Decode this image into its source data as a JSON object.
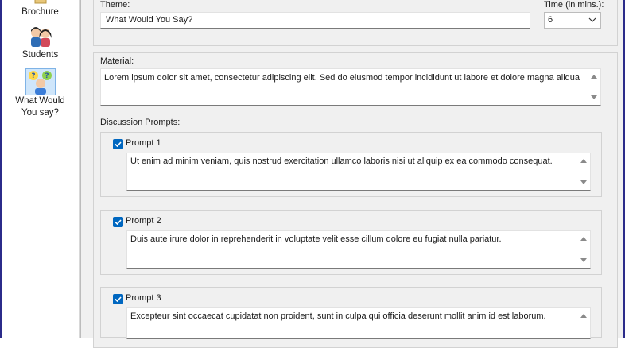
{
  "sidebar": {
    "items": [
      {
        "label": "Brochure",
        "icon": "brochure-icon"
      },
      {
        "label": "Students",
        "icon": "students-icon"
      },
      {
        "label": "What Would\nYou say?",
        "icon": "what-would-you-say-icon",
        "selected": true
      }
    ]
  },
  "form": {
    "theme_label": "Theme:",
    "theme_value": "What Would You Say?",
    "time_label": "Time (in mins.):",
    "time_value": "6",
    "material_label": "Material:",
    "material_value": "Lorem ipsum dolor sit amet, consectetur adipiscing elit. Sed do eiusmod tempor incididunt ut labore et dolore magna aliqua",
    "prompts_label": "Discussion Prompts:",
    "prompts": [
      {
        "title": "Prompt 1",
        "checked": true,
        "text": "Ut enim ad minim veniam, quis nostrud exercitation ullamco laboris nisi ut aliquip ex ea commodo consequat."
      },
      {
        "title": "Prompt 2",
        "checked": true,
        "text": "Duis aute irure dolor in reprehenderit in voluptate velit esse cillum dolore eu fugiat nulla pariatur."
      },
      {
        "title": "Prompt 3",
        "checked": true,
        "text": "Excepteur sint occaecat cupidatat non proident, sunt in culpa qui officia deserunt mollit anim id est laborum."
      }
    ]
  },
  "colors": {
    "accent": "#0067c0",
    "window_frame": "#2b2b8a",
    "panel_bg": "#f0f0f0"
  }
}
